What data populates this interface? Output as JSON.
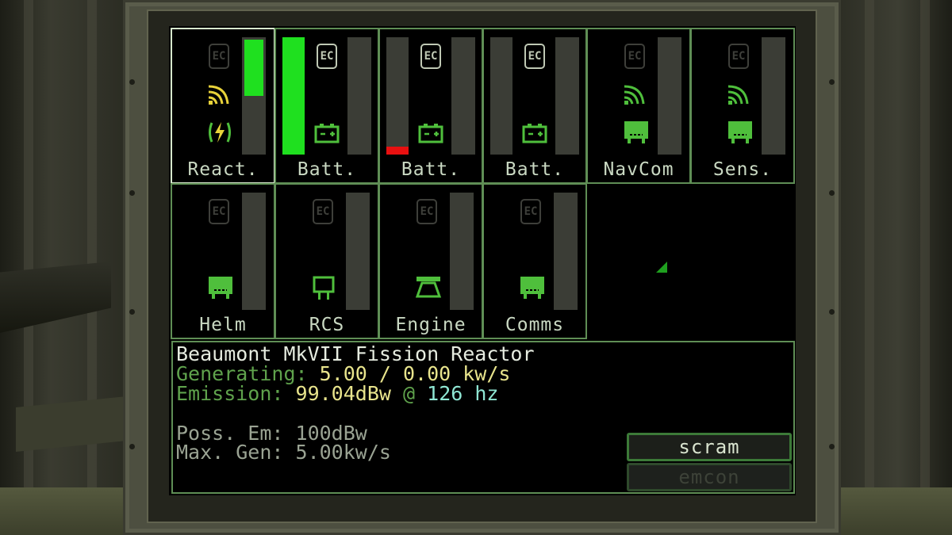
{
  "tiles": [
    {
      "id": "reactor",
      "label": "React.",
      "selected": true,
      "fill": 0.48,
      "fill_color": "#1fe01f",
      "ec_lit": false,
      "signal": "#e8d23a",
      "icon": "reactor-icon"
    },
    {
      "id": "battery1",
      "label": "Batt.",
      "selected": false,
      "fill": 1.0,
      "fill_color": "#1fe01f",
      "ec_lit": true,
      "signal": null,
      "icon": "battery-icon"
    },
    {
      "id": "battery2",
      "label": "Batt.",
      "selected": false,
      "fill": 0.07,
      "fill_color": "#e81010",
      "ec_lit": true,
      "signal": null,
      "icon": "battery-icon"
    },
    {
      "id": "battery3",
      "label": "Batt.",
      "selected": false,
      "fill": 0.0,
      "fill_color": "#1fe01f",
      "ec_lit": true,
      "signal": null,
      "icon": "battery-icon"
    },
    {
      "id": "navcom",
      "label": "NavCom",
      "selected": false,
      "fill": 0.0,
      "fill_color": "#1fe01f",
      "ec_lit": false,
      "signal": "#4fbf3c",
      "icon": "module-icon"
    },
    {
      "id": "sensors",
      "label": "Sens.",
      "selected": false,
      "fill": 0.0,
      "fill_color": "#1fe01f",
      "ec_lit": false,
      "signal": "#4fbf3c",
      "icon": "module-icon"
    },
    {
      "id": "helm",
      "label": "Helm",
      "selected": false,
      "fill": 0.0,
      "fill_color": "#1fe01f",
      "ec_lit": false,
      "signal": null,
      "icon": "module-icon"
    },
    {
      "id": "rcs",
      "label": "RCS",
      "selected": false,
      "fill": 0.0,
      "fill_color": "#1fe01f",
      "ec_lit": false,
      "signal": null,
      "icon": "rcs-icon"
    },
    {
      "id": "engine",
      "label": "Engine",
      "selected": false,
      "fill": 0.0,
      "fill_color": "#1fe01f",
      "ec_lit": false,
      "signal": null,
      "icon": "engine-icon"
    },
    {
      "id": "comms",
      "label": "Comms",
      "selected": false,
      "fill": 0.0,
      "fill_color": "#1fe01f",
      "ec_lit": false,
      "signal": null,
      "icon": "module-icon"
    }
  ],
  "ec_text": "EC",
  "info": {
    "title": "Beaumont MkVII Fission Reactor",
    "generating_label": "Generating:",
    "generating_value": "5.00 / 0.00 kw/s",
    "emission_label": "Emission:",
    "emission_value": "99.04dBw",
    "emission_at": "@",
    "emission_freq": "126 hz",
    "poss_em": "Poss. Em: 100dBw",
    "max_gen": "Max. Gen: 5.00kw/s"
  },
  "buttons": {
    "scram": "scram",
    "emcon": "emcon"
  },
  "colors": {
    "tile_border": "#5f8e55",
    "selected_border": "#d7e8cd",
    "text_green": "#5fa24c",
    "text_yellow": "#e8e48c",
    "text_cyan": "#8fe6d3"
  }
}
